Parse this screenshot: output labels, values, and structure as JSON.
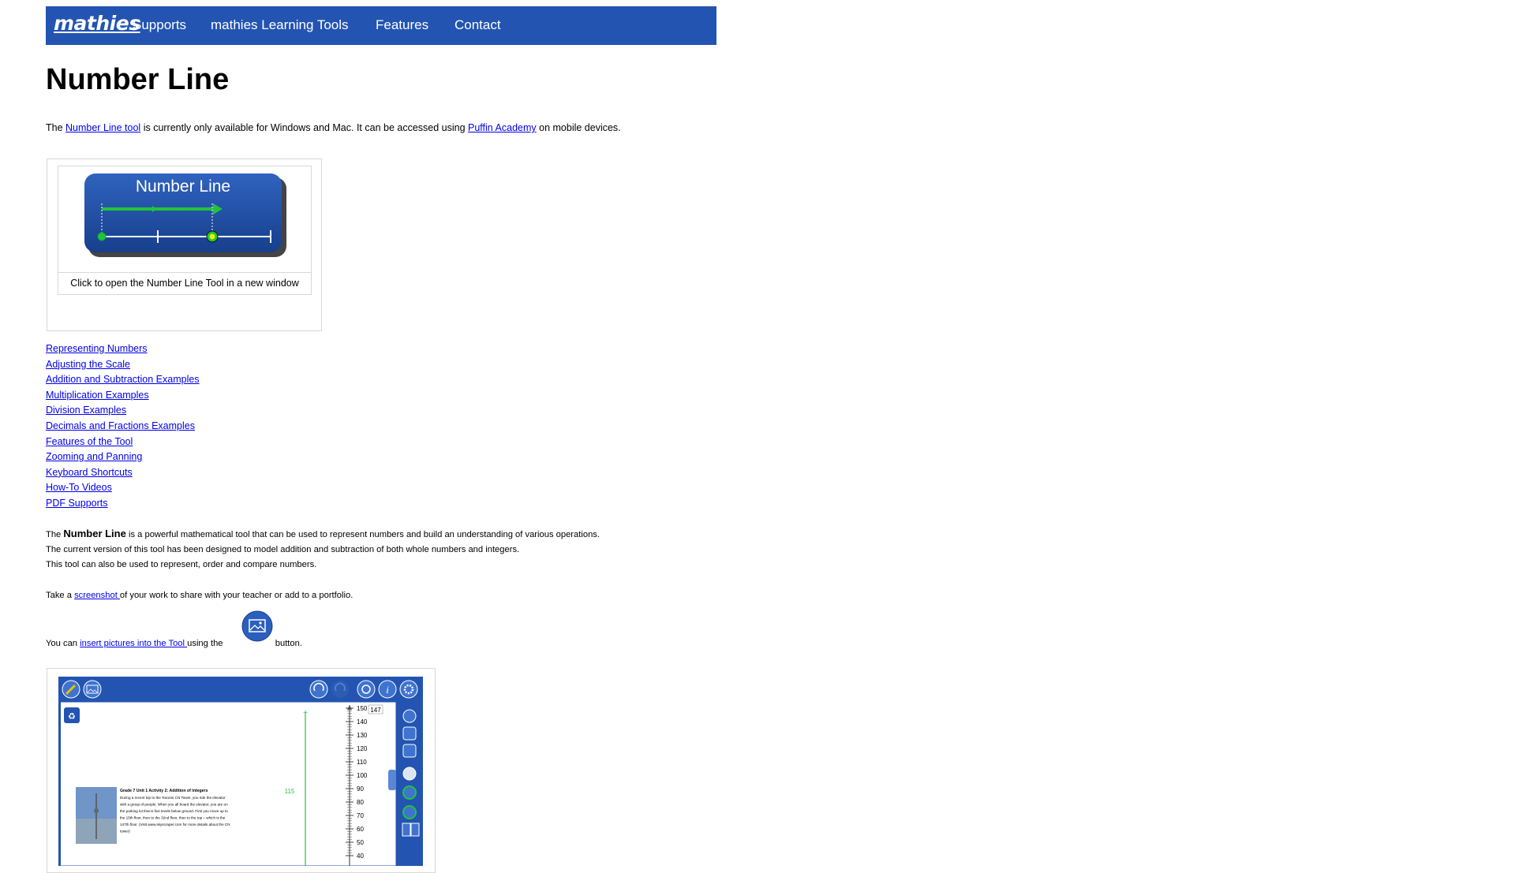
{
  "nav": {
    "logo": "mathies",
    "items": [
      "Supports",
      "mathies Learning Tools",
      "Features",
      "Contact"
    ]
  },
  "page": {
    "title": "Number Line",
    "intro": {
      "pre": "The ",
      "link1": "Number Line tool",
      "mid": " is currently only available for Windows and Mac. It can be accessed using ",
      "link2": "Puffin Academy",
      "post": " on mobile devices."
    }
  },
  "tool_card": {
    "tile_title": "Number Line",
    "caption": "Click to open the Number Line Tool in a new window"
  },
  "toc": [
    "Representing Numbers",
    "Adjusting the Scale",
    "Addition and Subtraction Examples",
    "Multiplication Examples",
    "Division Examples",
    "Decimals and Fractions Examples",
    "Features of the Tool",
    "Zooming and Panning",
    "Keyboard Shortcuts",
    "How-To Videos",
    "PDF Supports"
  ],
  "description": {
    "line1_pre": "The ",
    "line1_bold": "Number Line",
    "line1_post": " is a powerful mathematical tool that can be used to represent numbers and build an understanding of various operations.",
    "line2": "The current version of this tool has been designed to model addition and subtraction of both whole numbers and integers.",
    "line3": "This tool can also be used to represent, order and compare numbers."
  },
  "screenshot_para": {
    "pre": "Take a ",
    "link": "screenshot ",
    "post": "of your work to share with your teacher or add to a portfolio."
  },
  "insert_para": {
    "pre": "You can ",
    "link": "insert pictures into the Tool ",
    "mid": "using the ",
    "post": " button."
  },
  "tool_screenshot": {
    "scale_labels": [
      "150",
      "140",
      "130",
      "120",
      "110",
      "100",
      "90",
      "80",
      "70",
      "60",
      "50",
      "40"
    ],
    "value_tag": "147",
    "marker_label": "115",
    "activity_title": "Grade 7 Unit 1 Activity 2: Addition of Integers",
    "activity_text": [
      "During a recent trip to the Toronto CN Tower, you ride the elevator",
      "with a group of people.  When you all board the elevator, you are on",
      "the parking lot that is five levels below ground.  First you move up to",
      "the 15th floor, then to the 32nd floor, then to the top – which is the",
      "147th floor.  (Visit www.skyscraper.com for more details about the CN",
      "tower)"
    ]
  },
  "colors": {
    "nav_bg": "#2354b1",
    "link": "#0000ee",
    "tile_blue": "#1e4ea3",
    "line_green": "#22c33b"
  },
  "icons": [
    "pencil-icon",
    "image-icon",
    "undo-icon",
    "redo-icon",
    "refresh-icon",
    "info-icon",
    "gear-icon",
    "recycle-icon"
  ]
}
